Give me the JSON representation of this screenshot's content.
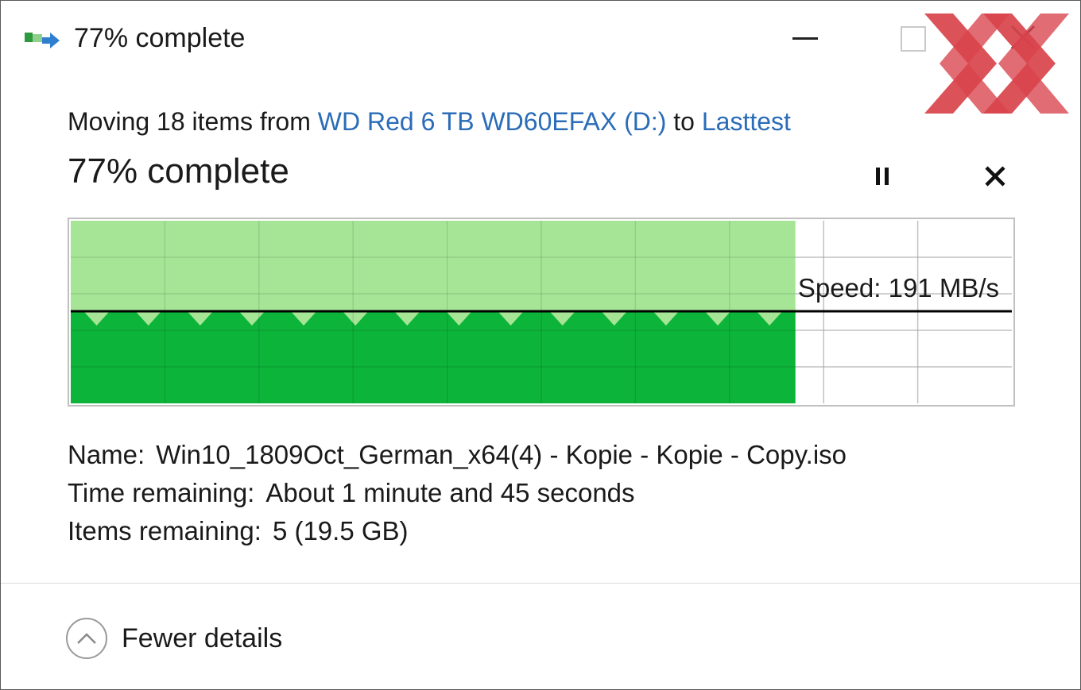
{
  "window": {
    "title": "77% complete",
    "icons": {
      "app": "file-move-icon",
      "minimize": "minimize-icon",
      "maximize": "maximize-icon",
      "close": "close-icon",
      "logo": "hardwareluxx-xx-logo"
    }
  },
  "operation": {
    "prefix": "Moving 18 items from ",
    "source": "WD Red 6 TB WD60EFAX (D:)",
    "middle": " to ",
    "destination": "Lasttest",
    "status": "77% complete",
    "progress_percent": 77,
    "pause_icon": "pause-icon",
    "cancel_icon": "cancel-icon"
  },
  "graph": {
    "speed_label": "Speed: 191 MB/s",
    "colors": {
      "fill_dark": "#0db43a",
      "fill_light": "#a6e596",
      "grid": "#d8d8d8",
      "speed_line": "#000000"
    }
  },
  "details": {
    "name_label": "Name:",
    "name_value": "Win10_1809Oct_German_x64(4) - Kopie - Kopie - Copy.iso",
    "time_label": "Time remaining:",
    "time_value": "About 1 minute and 45 seconds",
    "items_label": "Items remaining:",
    "items_value": "5 (19.5 GB)"
  },
  "footer": {
    "toggle_label": "Fewer details",
    "toggle_icon": "chevron-up-icon"
  },
  "colors": {
    "link": "#2a6cb7",
    "accent_logo": "#d9434b"
  }
}
